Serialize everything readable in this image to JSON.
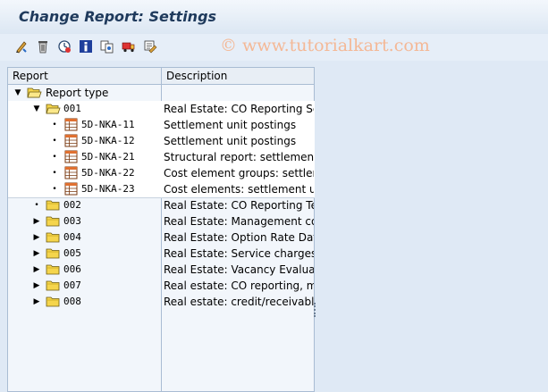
{
  "title": "Change Report: Settings",
  "watermark": "© www.tutorialkart.com",
  "toolbar": {
    "buttons": [
      {
        "name": "display-change-icon",
        "title": "Display/Change"
      },
      {
        "name": "delete-icon",
        "title": "Delete"
      },
      {
        "name": "check-icon",
        "title": "Check"
      },
      {
        "name": "info-icon",
        "title": "Information"
      },
      {
        "name": "hierarchy-icon",
        "title": "Hierarchy"
      },
      {
        "name": "transport-icon",
        "title": "Transport"
      },
      {
        "name": "settings-icon",
        "title": "Settings"
      }
    ]
  },
  "tree": {
    "columns": {
      "report": "Report",
      "description": "Description"
    },
    "root_label": "Report type",
    "rows": [
      {
        "code": "001",
        "desc": "Real Estate: CO Reporting Sett",
        "kind": "folder-open",
        "expander": "▼",
        "level": 1
      },
      {
        "code": "5D-NKA-11",
        "desc": "Settlement unit postings",
        "kind": "report",
        "expander": "•",
        "level": 2
      },
      {
        "code": "5D-NKA-12",
        "desc": "Settlement unit postings",
        "kind": "report",
        "expander": "•",
        "level": 2
      },
      {
        "code": "5D-NKA-21",
        "desc": "Structural report: settlement u",
        "kind": "report",
        "expander": "•",
        "level": 2
      },
      {
        "code": "5D-NKA-22",
        "desc": "Cost element groups: settleme",
        "kind": "report",
        "expander": "•",
        "level": 2
      },
      {
        "code": "5D-NKA-23",
        "desc": "Cost elements: settlement unit",
        "kind": "report",
        "expander": "•",
        "level": 2
      },
      {
        "code": "002",
        "desc": "Real Estate: CO Reporting Tena",
        "kind": "folder",
        "expander": "•",
        "level": 1
      },
      {
        "code": "003",
        "desc": "Real Estate: Management cont",
        "kind": "folder",
        "expander": "▶",
        "level": 1
      },
      {
        "code": "004",
        "desc": "Real Estate: Option Rate Data",
        "kind": "folder",
        "expander": "▶",
        "level": 1
      },
      {
        "code": "005",
        "desc": "Real Estate: Service charges se",
        "kind": "folder",
        "expander": "▶",
        "level": 1
      },
      {
        "code": "006",
        "desc": "Real Estate: Vacancy Evaluation",
        "kind": "folder",
        "expander": "▶",
        "level": 1
      },
      {
        "code": "007",
        "desc": "Real estate: CO reporting, mas",
        "kind": "folder",
        "expander": "▶",
        "level": 1
      },
      {
        "code": "008",
        "desc": "Real estate: credit/receivables",
        "kind": "folder",
        "expander": "▶",
        "level": 1
      }
    ]
  },
  "colors": {
    "titlebar": "#dce7f3",
    "tree_bg": "#f2f6fb",
    "selected_bg": "#ffffff",
    "folder": "#f5d54c"
  }
}
